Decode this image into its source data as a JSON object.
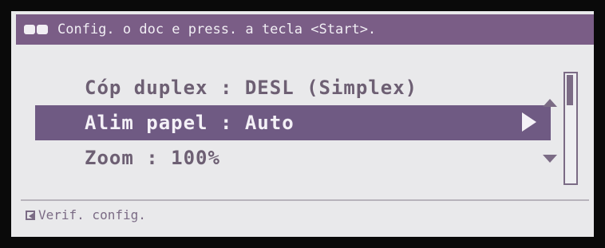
{
  "header": {
    "message": "Config. o doc e press. a tecla <Start>.",
    "icon": "cursor-keys-icon",
    "color": "#7a5d86"
  },
  "menu": {
    "items": [
      {
        "label": "Cóp duplex : DESL (Simplex)"
      },
      {
        "label": "Alim papel : Auto",
        "selected": true
      },
      {
        "label": "Zoom : 100%"
      }
    ]
  },
  "footer": {
    "label": "Verif. config.",
    "icon": "back-icon"
  },
  "colors": {
    "accent": "#6f5a83",
    "text": "#6d5f73",
    "background": "#e9e9eb"
  }
}
